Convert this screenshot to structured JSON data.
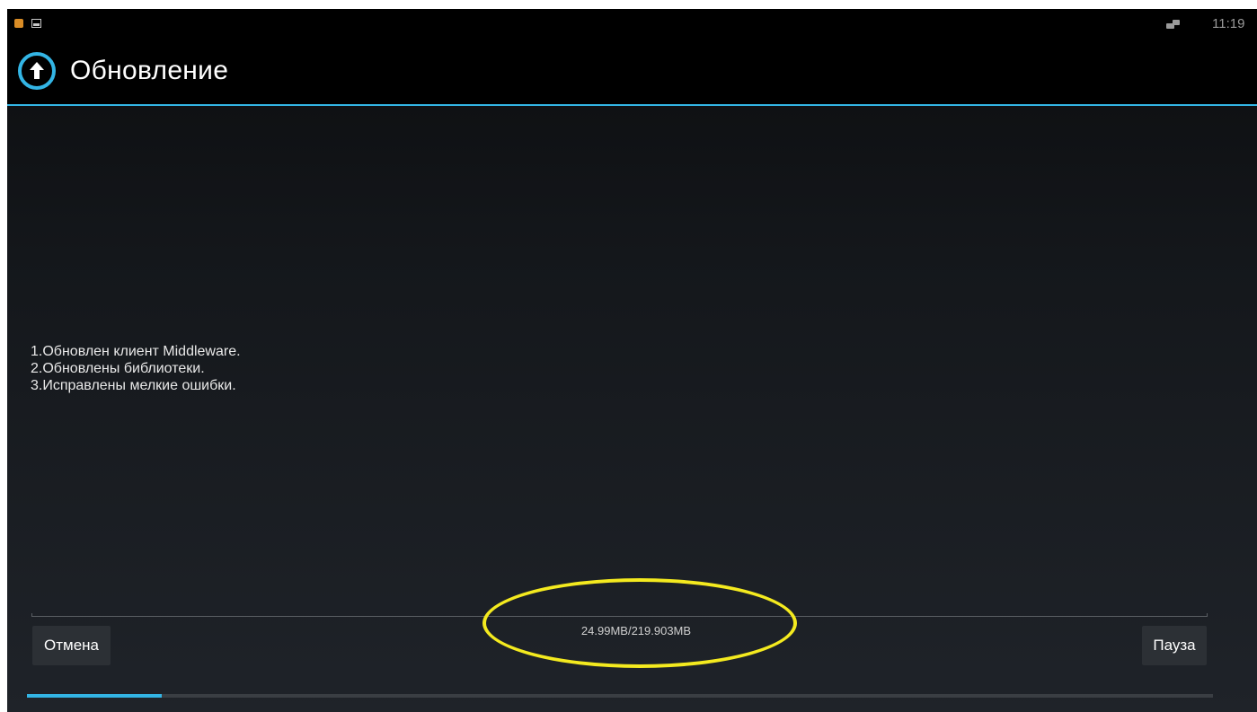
{
  "status_bar": {
    "time": "11:19",
    "icons": [
      "notification-icon",
      "gallery-icon",
      "network-icon"
    ]
  },
  "action_bar": {
    "title": "Обновление",
    "icon": "upload-arrow-icon",
    "accent_color": "#33b5e5"
  },
  "release_notes": [
    "1.Обновлен клиент Middleware.",
    "2.Обновлены библиотеки.",
    "3.Исправлены мелкие ошибки."
  ],
  "download": {
    "size_text": "24.99MB/219.903MB",
    "progress_fraction": 0.1136
  },
  "buttons": {
    "cancel_label": "Отмена",
    "pause_label": "Пауза"
  },
  "annotation": {
    "highlight_color": "#f4ea1f"
  }
}
